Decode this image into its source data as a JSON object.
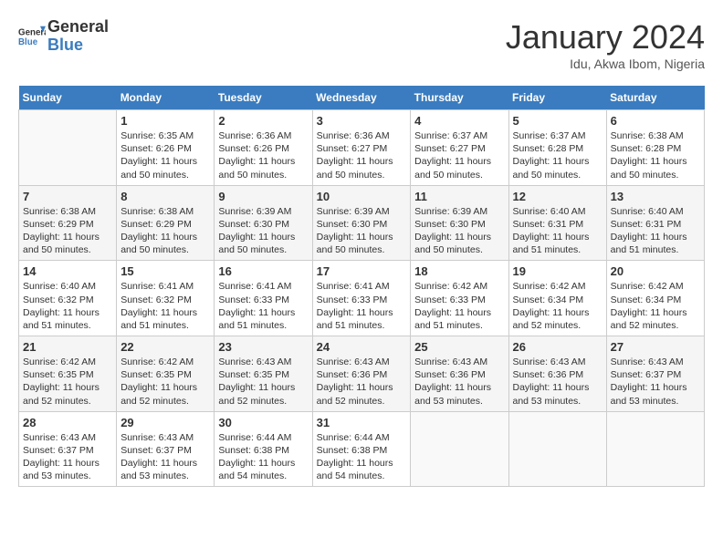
{
  "header": {
    "logo_line1": "General",
    "logo_line2": "Blue",
    "month_title": "January 2024",
    "location": "Idu, Akwa Ibom, Nigeria"
  },
  "days_of_week": [
    "Sunday",
    "Monday",
    "Tuesday",
    "Wednesday",
    "Thursday",
    "Friday",
    "Saturday"
  ],
  "weeks": [
    [
      {
        "num": "",
        "empty": true
      },
      {
        "num": "1",
        "sunrise": "6:35 AM",
        "sunset": "6:26 PM",
        "daylight": "11 hours and 50 minutes."
      },
      {
        "num": "2",
        "sunrise": "6:36 AM",
        "sunset": "6:26 PM",
        "daylight": "11 hours and 50 minutes."
      },
      {
        "num": "3",
        "sunrise": "6:36 AM",
        "sunset": "6:27 PM",
        "daylight": "11 hours and 50 minutes."
      },
      {
        "num": "4",
        "sunrise": "6:37 AM",
        "sunset": "6:27 PM",
        "daylight": "11 hours and 50 minutes."
      },
      {
        "num": "5",
        "sunrise": "6:37 AM",
        "sunset": "6:28 PM",
        "daylight": "11 hours and 50 minutes."
      },
      {
        "num": "6",
        "sunrise": "6:38 AM",
        "sunset": "6:28 PM",
        "daylight": "11 hours and 50 minutes."
      }
    ],
    [
      {
        "num": "7",
        "sunrise": "6:38 AM",
        "sunset": "6:29 PM",
        "daylight": "11 hours and 50 minutes."
      },
      {
        "num": "8",
        "sunrise": "6:38 AM",
        "sunset": "6:29 PM",
        "daylight": "11 hours and 50 minutes."
      },
      {
        "num": "9",
        "sunrise": "6:39 AM",
        "sunset": "6:30 PM",
        "daylight": "11 hours and 50 minutes."
      },
      {
        "num": "10",
        "sunrise": "6:39 AM",
        "sunset": "6:30 PM",
        "daylight": "11 hours and 50 minutes."
      },
      {
        "num": "11",
        "sunrise": "6:39 AM",
        "sunset": "6:30 PM",
        "daylight": "11 hours and 50 minutes."
      },
      {
        "num": "12",
        "sunrise": "6:40 AM",
        "sunset": "6:31 PM",
        "daylight": "11 hours and 51 minutes."
      },
      {
        "num": "13",
        "sunrise": "6:40 AM",
        "sunset": "6:31 PM",
        "daylight": "11 hours and 51 minutes."
      }
    ],
    [
      {
        "num": "14",
        "sunrise": "6:40 AM",
        "sunset": "6:32 PM",
        "daylight": "11 hours and 51 minutes."
      },
      {
        "num": "15",
        "sunrise": "6:41 AM",
        "sunset": "6:32 PM",
        "daylight": "11 hours and 51 minutes."
      },
      {
        "num": "16",
        "sunrise": "6:41 AM",
        "sunset": "6:33 PM",
        "daylight": "11 hours and 51 minutes."
      },
      {
        "num": "17",
        "sunrise": "6:41 AM",
        "sunset": "6:33 PM",
        "daylight": "11 hours and 51 minutes."
      },
      {
        "num": "18",
        "sunrise": "6:42 AM",
        "sunset": "6:33 PM",
        "daylight": "11 hours and 51 minutes."
      },
      {
        "num": "19",
        "sunrise": "6:42 AM",
        "sunset": "6:34 PM",
        "daylight": "11 hours and 52 minutes."
      },
      {
        "num": "20",
        "sunrise": "6:42 AM",
        "sunset": "6:34 PM",
        "daylight": "11 hours and 52 minutes."
      }
    ],
    [
      {
        "num": "21",
        "sunrise": "6:42 AM",
        "sunset": "6:35 PM",
        "daylight": "11 hours and 52 minutes."
      },
      {
        "num": "22",
        "sunrise": "6:42 AM",
        "sunset": "6:35 PM",
        "daylight": "11 hours and 52 minutes."
      },
      {
        "num": "23",
        "sunrise": "6:43 AM",
        "sunset": "6:35 PM",
        "daylight": "11 hours and 52 minutes."
      },
      {
        "num": "24",
        "sunrise": "6:43 AM",
        "sunset": "6:36 PM",
        "daylight": "11 hours and 52 minutes."
      },
      {
        "num": "25",
        "sunrise": "6:43 AM",
        "sunset": "6:36 PM",
        "daylight": "11 hours and 53 minutes."
      },
      {
        "num": "26",
        "sunrise": "6:43 AM",
        "sunset": "6:36 PM",
        "daylight": "11 hours and 53 minutes."
      },
      {
        "num": "27",
        "sunrise": "6:43 AM",
        "sunset": "6:37 PM",
        "daylight": "11 hours and 53 minutes."
      }
    ],
    [
      {
        "num": "28",
        "sunrise": "6:43 AM",
        "sunset": "6:37 PM",
        "daylight": "11 hours and 53 minutes."
      },
      {
        "num": "29",
        "sunrise": "6:43 AM",
        "sunset": "6:37 PM",
        "daylight": "11 hours and 53 minutes."
      },
      {
        "num": "30",
        "sunrise": "6:44 AM",
        "sunset": "6:38 PM",
        "daylight": "11 hours and 54 minutes."
      },
      {
        "num": "31",
        "sunrise": "6:44 AM",
        "sunset": "6:38 PM",
        "daylight": "11 hours and 54 minutes."
      },
      {
        "num": "",
        "empty": true
      },
      {
        "num": "",
        "empty": true
      },
      {
        "num": "",
        "empty": true
      }
    ]
  ],
  "labels": {
    "sunrise_prefix": "Sunrise: ",
    "sunset_prefix": "Sunset: ",
    "daylight_prefix": "Daylight: "
  }
}
